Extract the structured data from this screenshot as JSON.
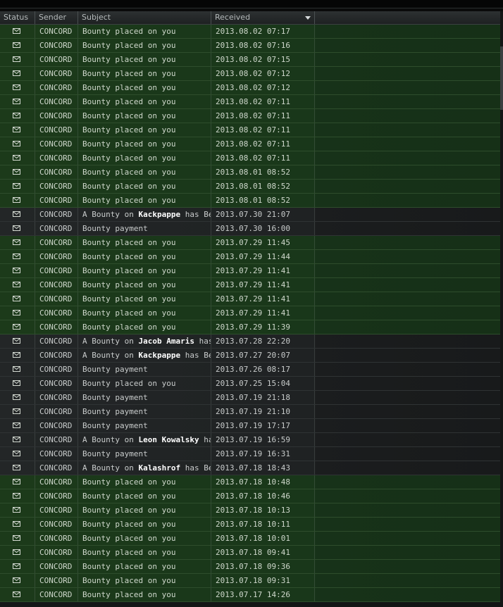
{
  "columns": {
    "status": "Status",
    "sender": "Sender",
    "subject": "Subject",
    "received": "Received"
  },
  "sort_indicator": "descending",
  "messages": [
    {
      "state": "unread",
      "sender": "CONCORD",
      "subject": "Bounty placed on you",
      "received": "2013.08.02 07:17"
    },
    {
      "state": "unread",
      "sender": "CONCORD",
      "subject": "Bounty placed on you",
      "received": "2013.08.02 07:16"
    },
    {
      "state": "unread",
      "sender": "CONCORD",
      "subject": "Bounty placed on you",
      "received": "2013.08.02 07:15"
    },
    {
      "state": "unread",
      "sender": "CONCORD",
      "subject": "Bounty placed on you",
      "received": "2013.08.02 07:12"
    },
    {
      "state": "unread",
      "sender": "CONCORD",
      "subject": "Bounty placed on you",
      "received": "2013.08.02 07:12"
    },
    {
      "state": "unread",
      "sender": "CONCORD",
      "subject": "Bounty placed on you",
      "received": "2013.08.02 07:11"
    },
    {
      "state": "unread",
      "sender": "CONCORD",
      "subject": "Bounty placed on you",
      "received": "2013.08.02 07:11"
    },
    {
      "state": "unread",
      "sender": "CONCORD",
      "subject": "Bounty placed on you",
      "received": "2013.08.02 07:11"
    },
    {
      "state": "unread",
      "sender": "CONCORD",
      "subject": "Bounty placed on you",
      "received": "2013.08.02 07:11"
    },
    {
      "state": "unread",
      "sender": "CONCORD",
      "subject": "Bounty placed on you",
      "received": "2013.08.02 07:11"
    },
    {
      "state": "unread",
      "sender": "CONCORD",
      "subject": "Bounty placed on you",
      "received": "2013.08.01 08:52"
    },
    {
      "state": "unread",
      "sender": "CONCORD",
      "subject": "Bounty placed on you",
      "received": "2013.08.01 08:52"
    },
    {
      "state": "unread",
      "sender": "CONCORD",
      "subject": "Bounty placed on you",
      "received": "2013.08.01 08:52"
    },
    {
      "state": "read",
      "sender": "CONCORD",
      "subject_pre": "A Bounty on ",
      "subject_bold": "Kackpappe",
      "subject_post": " has Bee",
      "received": "2013.07.30 21:07"
    },
    {
      "state": "read",
      "sender": "CONCORD",
      "subject": "Bounty payment",
      "received": "2013.07.30 16:00"
    },
    {
      "state": "unread",
      "sender": "CONCORD",
      "subject": "Bounty placed on you",
      "received": "2013.07.29 11:45"
    },
    {
      "state": "unread",
      "sender": "CONCORD",
      "subject": "Bounty placed on you",
      "received": "2013.07.29 11:44"
    },
    {
      "state": "unread",
      "sender": "CONCORD",
      "subject": "Bounty placed on you",
      "received": "2013.07.29 11:41"
    },
    {
      "state": "unread",
      "sender": "CONCORD",
      "subject": "Bounty placed on you",
      "received": "2013.07.29 11:41"
    },
    {
      "state": "unread",
      "sender": "CONCORD",
      "subject": "Bounty placed on you",
      "received": "2013.07.29 11:41"
    },
    {
      "state": "unread",
      "sender": "CONCORD",
      "subject": "Bounty placed on you",
      "received": "2013.07.29 11:41"
    },
    {
      "state": "unread",
      "sender": "CONCORD",
      "subject": "Bounty placed on you",
      "received": "2013.07.29 11:39"
    },
    {
      "state": "read",
      "sender": "CONCORD",
      "subject_pre": "A Bounty on ",
      "subject_bold": "Jacob Amaris",
      "subject_post": " has",
      "received": "2013.07.28 22:20"
    },
    {
      "state": "read",
      "sender": "CONCORD",
      "subject_pre": "A Bounty on ",
      "subject_bold": "Kackpappe",
      "subject_post": " has Bee",
      "received": "2013.07.27 20:07"
    },
    {
      "state": "read",
      "sender": "CONCORD",
      "subject": "Bounty payment",
      "received": "2013.07.26 08:17"
    },
    {
      "state": "read",
      "sender": "CONCORD",
      "subject": "Bounty placed on you",
      "received": "2013.07.25 15:04"
    },
    {
      "state": "read",
      "sender": "CONCORD",
      "subject": "Bounty payment",
      "received": "2013.07.19 21:18"
    },
    {
      "state": "read",
      "sender": "CONCORD",
      "subject": "Bounty payment",
      "received": "2013.07.19 21:10"
    },
    {
      "state": "read",
      "sender": "CONCORD",
      "subject": "Bounty payment",
      "received": "2013.07.19 17:17"
    },
    {
      "state": "read",
      "sender": "CONCORD",
      "subject_pre": "A Bounty on ",
      "subject_bold": "Leon Kowalsky",
      "subject_post": " has",
      "received": "2013.07.19 16:59"
    },
    {
      "state": "read",
      "sender": "CONCORD",
      "subject": "Bounty payment",
      "received": "2013.07.19 16:31"
    },
    {
      "state": "read",
      "sender": "CONCORD",
      "subject_pre": "A Bounty on ",
      "subject_bold": "Kalashrof",
      "subject_post": " has Been",
      "received": "2013.07.18 18:43"
    },
    {
      "state": "unread",
      "sender": "CONCORD",
      "subject": "Bounty placed on you",
      "received": "2013.07.18 10:48"
    },
    {
      "state": "unread",
      "sender": "CONCORD",
      "subject": "Bounty placed on you",
      "received": "2013.07.18 10:46"
    },
    {
      "state": "unread",
      "sender": "CONCORD",
      "subject": "Bounty placed on you",
      "received": "2013.07.18 10:13"
    },
    {
      "state": "unread",
      "sender": "CONCORD",
      "subject": "Bounty placed on you",
      "received": "2013.07.18 10:11"
    },
    {
      "state": "unread",
      "sender": "CONCORD",
      "subject": "Bounty placed on you",
      "received": "2013.07.18 10:01"
    },
    {
      "state": "unread",
      "sender": "CONCORD",
      "subject": "Bounty placed on you",
      "received": "2013.07.18 09:41"
    },
    {
      "state": "unread",
      "sender": "CONCORD",
      "subject": "Bounty placed on you",
      "received": "2013.07.18 09:36"
    },
    {
      "state": "unread",
      "sender": "CONCORD",
      "subject": "Bounty placed on you",
      "received": "2013.07.18 09:31"
    },
    {
      "state": "unread",
      "sender": "CONCORD",
      "subject": "Bounty placed on you",
      "received": "2013.07.17 14:26"
    }
  ],
  "icons": {
    "status": "envelope-icon",
    "sort": "sort-descending-icon"
  }
}
